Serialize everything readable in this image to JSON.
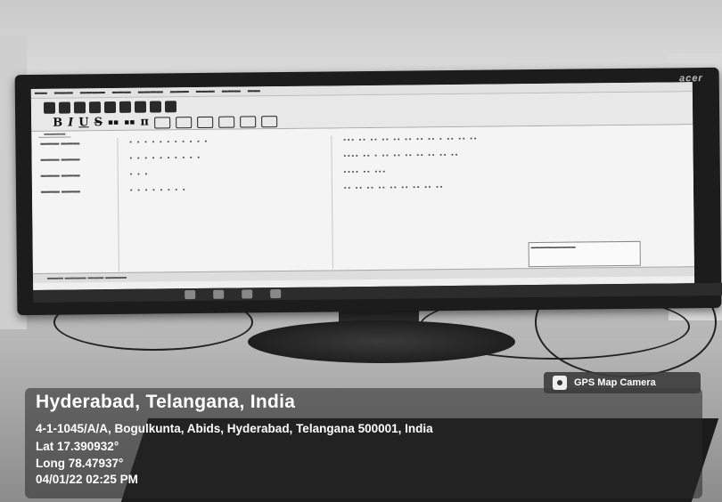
{
  "overlay": {
    "badge_label": "GPS Map Camera",
    "title": "Hyderabad, Telangana, India",
    "address": "4-1-1045/A/A, Bogulkunta, Abids, Hyderabad, Telangana 500001, India",
    "lat": "Lat 17.390932°",
    "long": "Long 78.47937°",
    "datetime": "04/01/22 02:25 PM"
  },
  "monitor": {
    "brand": "acer"
  }
}
